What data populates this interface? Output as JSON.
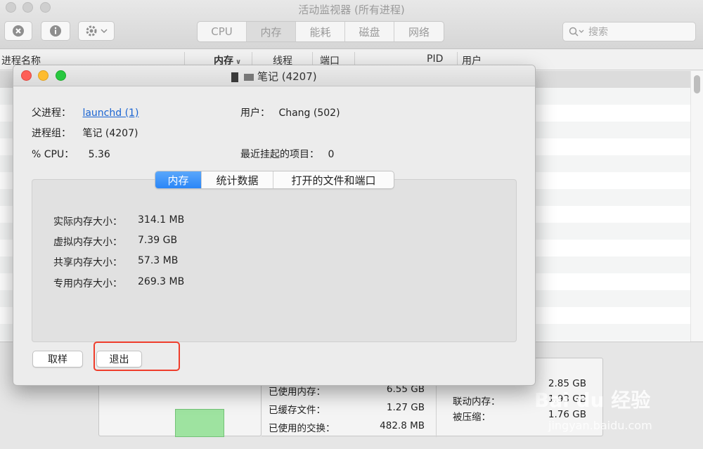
{
  "window": {
    "title": "活动监视器 (所有进程)"
  },
  "toolbar": {
    "stop_icon": "stop-process-icon",
    "info_icon": "info-icon",
    "gear_icon": "gear-icon",
    "tabs": [
      "CPU",
      "内存",
      "能耗",
      "磁盘",
      "网络"
    ],
    "active_tab": "内存",
    "search_placeholder": "搜索"
  },
  "columns": [
    "进程名称",
    "内存",
    "线程",
    "端口",
    "PID",
    "用户"
  ],
  "dialog": {
    "title_suffix": "笔记 (4207)",
    "parent_label": "父进程：",
    "parent_value": "launchd (1)",
    "group_label": "进程组：",
    "group_value": "笔记 (4207)",
    "cpu_label": "% CPU：",
    "cpu_value": "5.36",
    "user_label": "用户：",
    "user_value": "Chang (502)",
    "suspended_label": "最近挂起的项目：",
    "suspended_value": "0",
    "tabs": [
      "内存",
      "统计数据",
      "打开的文件和端口"
    ],
    "active_tab": "内存",
    "memory": [
      {
        "label": "实际内存大小：",
        "value": "314.1 MB"
      },
      {
        "label": "虚拟内存大小：",
        "value": "7.39 GB"
      },
      {
        "label": "共享内存大小：",
        "value": "57.3 MB"
      },
      {
        "label": "专用内存大小：",
        "value": "269.3 MB"
      }
    ],
    "sample_button": "取样",
    "quit_button": "退出"
  },
  "summary": {
    "used_memory_label": "已使用内存：",
    "used_memory_value": "6.55 GB",
    "cached_files_label": "已缓存文件：",
    "cached_files_value": "1.27 GB",
    "swap_label": "已使用的交换：",
    "swap_value": "482.8 MB",
    "app_memory_value": "2.85 GB",
    "wired_label": "联动内存：",
    "wired_value": "1.93 GB",
    "compressed_label": "被压缩：",
    "compressed_value": "1.76 GB"
  },
  "watermark": {
    "brand": "Bai du 经验",
    "url": "jingyan.baidu.com"
  }
}
